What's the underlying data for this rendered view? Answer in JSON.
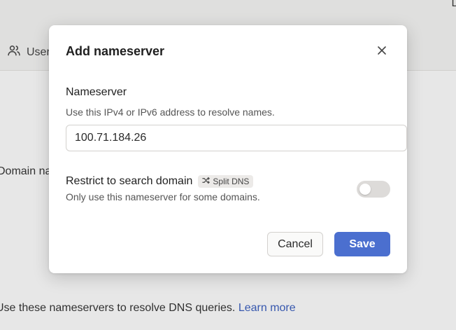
{
  "background": {
    "top_right_text": "L",
    "nav_item": "Users",
    "domain_text": "Domain names",
    "dns_text": "Use these nameservers to resolve DNS queries.",
    "learn_more": "Learn more"
  },
  "modal": {
    "title": "Add nameserver",
    "nameserver_label": "Nameserver",
    "nameserver_help": "Use this IPv4 or IPv6 address to resolve names.",
    "nameserver_value": "100.71.184.26",
    "restrict_label": "Restrict to search domain",
    "badge_label": "Split DNS",
    "restrict_help": "Only use this nameserver for some domains.",
    "toggle_on": false,
    "cancel_label": "Cancel",
    "save_label": "Save"
  },
  "colors": {
    "accent": "#4b6fcf",
    "link": "#3a5fbf",
    "toggle_off": "#dddbd9"
  },
  "icons": {
    "nav": "users-icon",
    "close": "close-icon",
    "badge": "shuffle-icon"
  }
}
